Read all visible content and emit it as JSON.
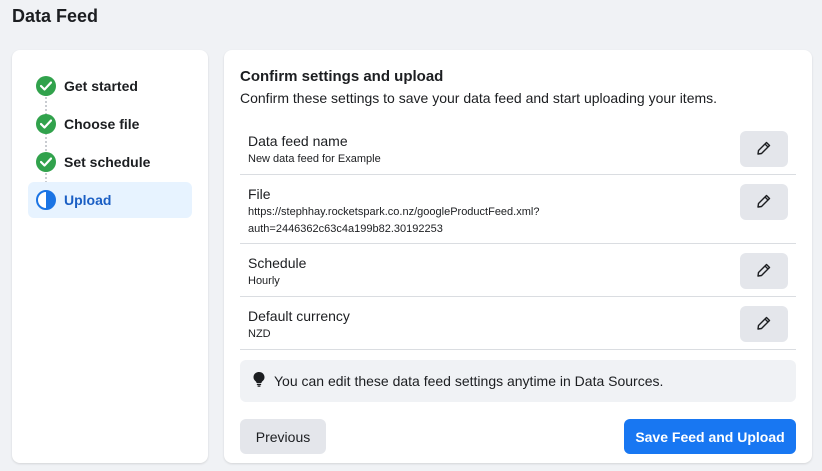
{
  "page": {
    "title": "Data Feed"
  },
  "stepper": {
    "steps": [
      {
        "label": "Get started",
        "state": "done",
        "icon": "check-circle-icon"
      },
      {
        "label": "Choose file",
        "state": "done",
        "icon": "check-circle-icon"
      },
      {
        "label": "Set schedule",
        "state": "done",
        "icon": "check-circle-icon"
      },
      {
        "label": "Upload",
        "state": "current",
        "icon": "half-circle-icon"
      }
    ]
  },
  "confirm": {
    "title": "Confirm settings and upload",
    "subtitle": "Confirm these settings to save your data feed and start uploading your items.",
    "rows": [
      {
        "label": "Data feed name",
        "value": "New data feed for Example"
      },
      {
        "label": "File",
        "value_line1": "https://stephhay.rocketspark.co.nz/googleProductFeed.xml?",
        "value_line2": "auth=2446362c63c4a199b82.30192253"
      },
      {
        "label": "Schedule",
        "value": "Hourly"
      },
      {
        "label": "Default currency",
        "value": "NZD"
      }
    ],
    "edit_icon": "pencil-icon",
    "info": {
      "icon": "lightbulb-icon",
      "text": "You can edit these data feed settings anytime in Data Sources."
    }
  },
  "actions": {
    "previous_label": "Previous",
    "save_label": "Save Feed and Upload"
  },
  "colors": {
    "accent": "#1877f2",
    "success": "#31a24c",
    "active_bg": "#e7f3ff"
  }
}
